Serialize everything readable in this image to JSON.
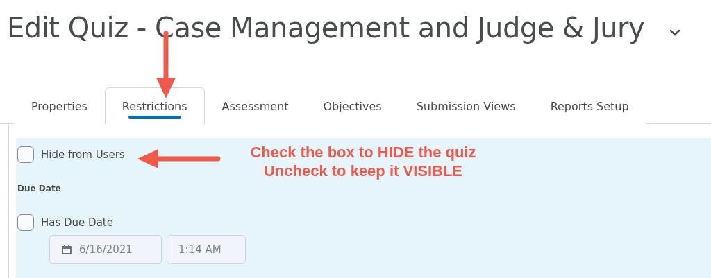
{
  "page_title": "Edit Quiz - Case Management and Judge & Jury",
  "tabs": [
    {
      "label": "Properties",
      "selected": false
    },
    {
      "label": "Restrictions",
      "selected": true
    },
    {
      "label": "Assessment",
      "selected": false
    },
    {
      "label": "Objectives",
      "selected": false
    },
    {
      "label": "Submission Views",
      "selected": false
    },
    {
      "label": "Reports Setup",
      "selected": false
    }
  ],
  "hide_from_users": {
    "label": "Hide from Users",
    "checked": false
  },
  "due_date": {
    "heading": "Due Date",
    "label": "Has Due Date",
    "checked": false,
    "date": "6/16/2021",
    "time": "1:14 AM"
  },
  "annotation": {
    "lines": [
      "Check the box to HIDE the quiz",
      "Uncheck to keep it VISIBLE"
    ]
  }
}
